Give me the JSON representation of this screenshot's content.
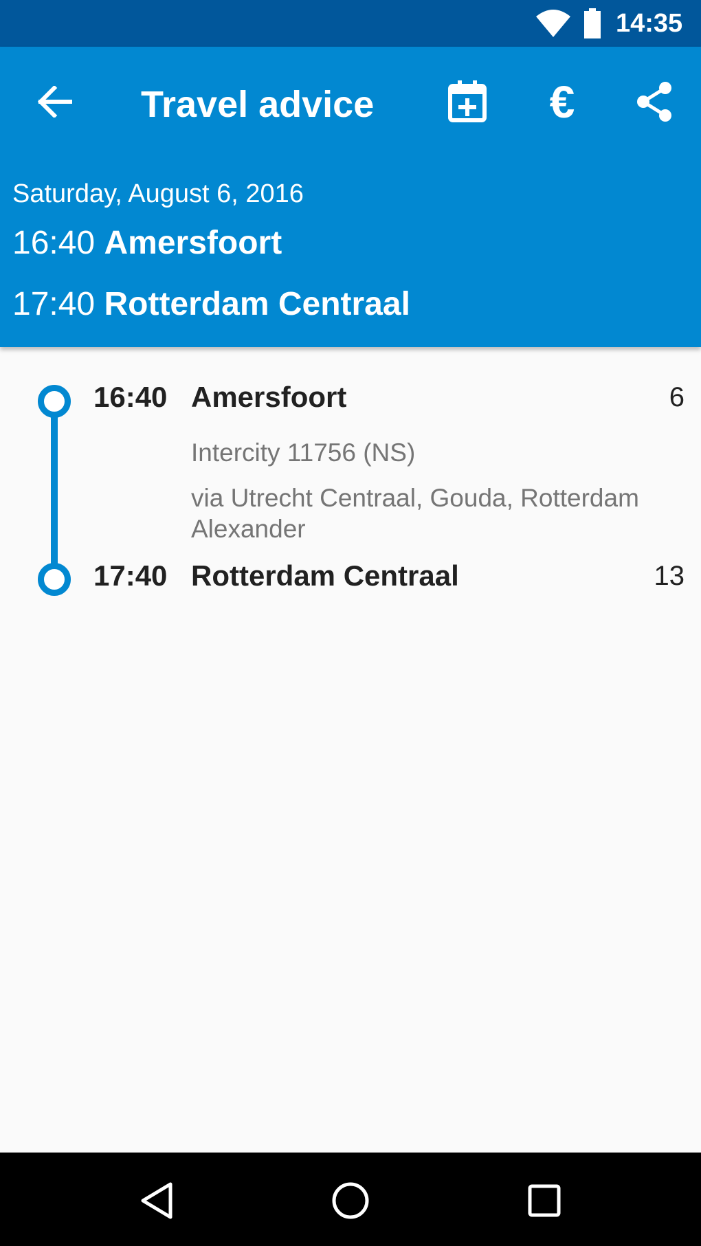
{
  "status_bar": {
    "time": "14:35",
    "icons": [
      "wifi-icon",
      "battery-icon"
    ]
  },
  "app_bar": {
    "title": "Travel advice",
    "actions": [
      "back-arrow-icon",
      "calendar-add-icon",
      "euro-icon",
      "share-icon"
    ],
    "euro_symbol": "€"
  },
  "summary": {
    "date": "Saturday, August 6, 2016",
    "departure": {
      "time": "16:40",
      "station": "Amersfoort"
    },
    "arrival": {
      "time": "17:40",
      "station": "Rotterdam Centraal"
    }
  },
  "legs": [
    {
      "departure": {
        "time": "16:40",
        "station": "Amersfoort",
        "platform": "6"
      },
      "train": "Intercity 11756 (NS)",
      "via": "via Utrecht Centraal, Gouda, Rotterdam Alexander",
      "arrival": {
        "time": "17:40",
        "station": "Rotterdam Centraal",
        "platform": "13"
      }
    }
  ],
  "nav_bar": {
    "buttons": [
      "back-triangle-icon",
      "home-circle-icon",
      "recents-square-icon"
    ]
  },
  "colors": {
    "primary": "#0288d1",
    "primary_dark": "#01579b",
    "background": "#fafafa"
  }
}
